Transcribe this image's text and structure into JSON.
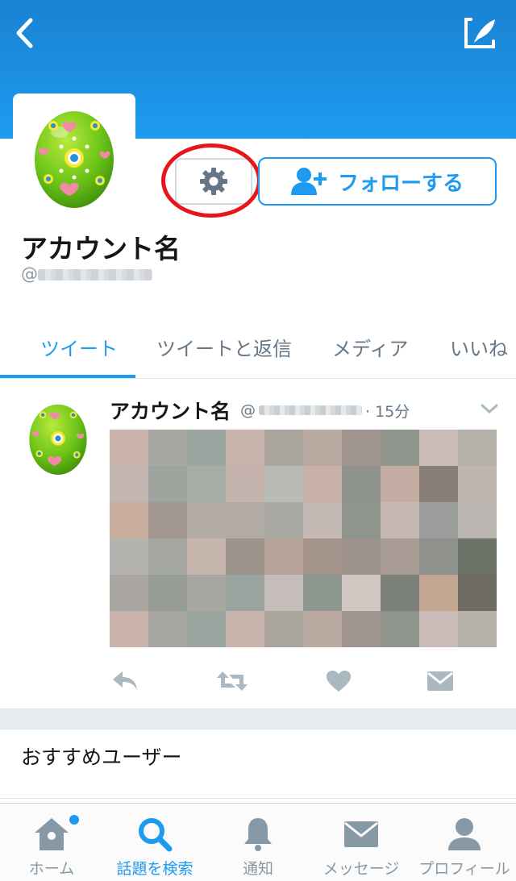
{
  "header": {
    "back_icon": "chevron-left-icon",
    "compose_icon": "compose-tweet-icon"
  },
  "profile": {
    "name": "アカウント名",
    "handle_prefix": "@",
    "settings_icon": "gear-icon",
    "follow_label": "フォローする",
    "follow_icon": "add-user-icon"
  },
  "tabs": [
    {
      "label": "ツイート",
      "active": true
    },
    {
      "label": "ツイートと返信",
      "active": false
    },
    {
      "label": "メディア",
      "active": false
    },
    {
      "label": "いいね",
      "active": false
    }
  ],
  "tweet": {
    "author": "アカウント名",
    "handle_prefix": "@",
    "time": "· 15分",
    "actions": [
      "reply-icon",
      "retweet-icon",
      "like-icon",
      "direct-message-icon"
    ]
  },
  "suggested": {
    "label": "おすすめユーザー"
  },
  "tabbar": [
    {
      "label": "ホーム",
      "icon": "home-icon",
      "active": false,
      "badge": true
    },
    {
      "label": "話題を検索",
      "icon": "search-icon",
      "active": true
    },
    {
      "label": "通知",
      "icon": "bell-icon",
      "active": false
    },
    {
      "label": "メッセージ",
      "icon": "envelope-icon",
      "active": false
    },
    {
      "label": "プロフィール",
      "icon": "profile-icon",
      "active": false
    }
  ],
  "colors": {
    "accent": "#1d9bf0",
    "highlight": "#e6161a",
    "icon_gray": "#8899a6"
  }
}
